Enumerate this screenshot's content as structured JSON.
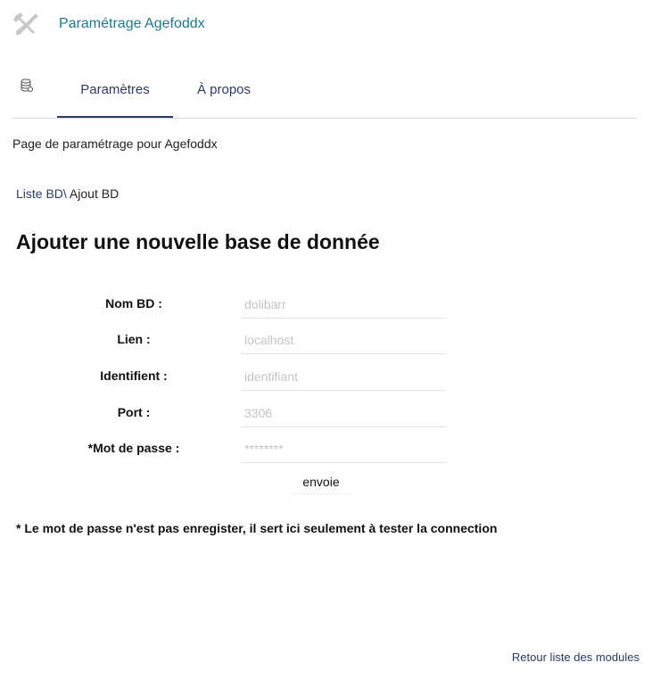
{
  "header": {
    "title": "Paramétrage Agefoddx",
    "icon": "tools-icon"
  },
  "tabs": [
    {
      "label": "Paramètres",
      "active": true
    },
    {
      "label": "À propos",
      "active": false
    }
  ],
  "intro": "Page de paramétrage pour Agefoddx",
  "breadcrumb": {
    "link": "Liste BD\\",
    "current": " Ajout BD"
  },
  "form": {
    "title": "Ajouter une nouvelle base de donnée",
    "fields": [
      {
        "label": "Nom BD :",
        "placeholder": "dolibarr"
      },
      {
        "label": "Lien :",
        "placeholder": "localhost"
      },
      {
        "label": "Identifient :",
        "placeholder": "identifiant"
      },
      {
        "label": "Port :",
        "placeholder": "3306"
      },
      {
        "label": "*Mot de passe :",
        "placeholder": "********"
      }
    ],
    "submit_label": "envoie"
  },
  "note": "* Le mot de passe n'est pas enregister, il sert ici seulement à tester la connection",
  "footer": {
    "back_link": "Retour liste des modules"
  },
  "colors": {
    "accent": "#1f7a8c",
    "link": "#2b3a68"
  }
}
